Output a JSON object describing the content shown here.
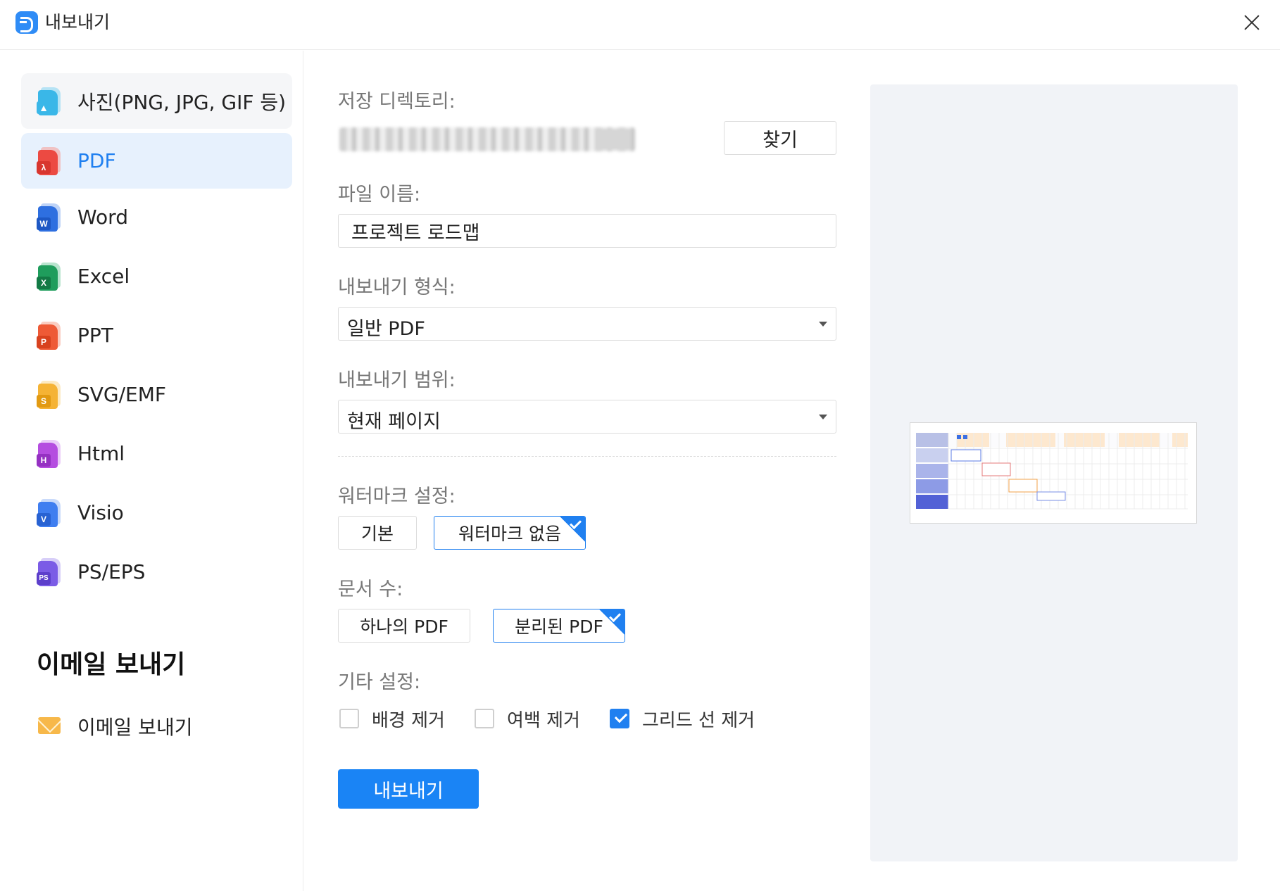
{
  "window": {
    "title": "내보내기"
  },
  "sidebar": {
    "items": [
      {
        "label": "사진(PNG, JPG, GIF 등)",
        "icon": "image-file-icon",
        "color": "#3ab7e8",
        "badge": ""
      },
      {
        "label": "PDF",
        "icon": "pdf-file-icon",
        "color": "#ec4a42",
        "badge": ""
      },
      {
        "label": "Word",
        "icon": "word-file-icon",
        "color": "#2e6fe0",
        "badge": "W"
      },
      {
        "label": "Excel",
        "icon": "excel-file-icon",
        "color": "#1f9d5c",
        "badge": "X"
      },
      {
        "label": "PPT",
        "icon": "ppt-file-icon",
        "color": "#ee5a36",
        "badge": "P"
      },
      {
        "label": "SVG/EMF",
        "icon": "svg-file-icon",
        "color": "#f5b335",
        "badge": "S"
      },
      {
        "label": "Html",
        "icon": "html-file-icon",
        "color": "#b54de0",
        "badge": "H"
      },
      {
        "label": "Visio",
        "icon": "visio-file-icon",
        "color": "#3f7ef0",
        "badge": "V"
      },
      {
        "label": "PS/EPS",
        "icon": "ps-file-icon",
        "color": "#7b5ce6",
        "badge": "PS"
      }
    ],
    "email_heading": "이메일 보내기",
    "email_item": {
      "label": "이메일 보내기",
      "icon": "envelope-icon"
    }
  },
  "form": {
    "save_dir_label": "저장 디렉토리:",
    "browse_label": "찾기",
    "file_name_label": "파일 이름:",
    "file_name_value": "프로젝트 로드맵",
    "format_label": "내보내기 형식:",
    "format_value": "일반 PDF",
    "range_label": "내보내기 범위:",
    "range_value": "현재 페이지",
    "watermark_label": "워터마크 설정:",
    "watermark_options": [
      "기본",
      "워터마크 없음"
    ],
    "watermark_selected": "워터마크 없음",
    "doc_count_label": "문서 수:",
    "doc_count_options": [
      "하나의 PDF",
      "분리된 PDF"
    ],
    "doc_count_selected": "분리된 PDF",
    "other_label": "기타 설정:",
    "checkboxes": [
      {
        "label": "배경 제거",
        "checked": false
      },
      {
        "label": "여백 제거",
        "checked": false
      },
      {
        "label": "그리드 선 제거",
        "checked": true
      }
    ],
    "export_label": "내보내기"
  },
  "colors": {
    "accent": "#2080f0",
    "export_button": "#1a84f5"
  }
}
